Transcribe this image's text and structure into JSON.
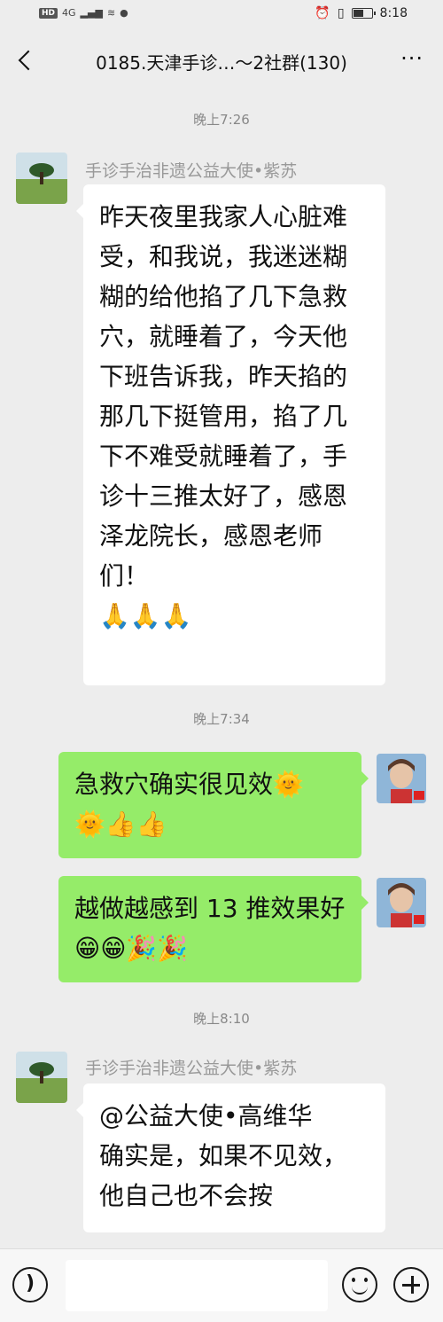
{
  "status_bar": {
    "hd": "HD",
    "network": "4G",
    "time": "8:18",
    "battery_level": 0.6
  },
  "header": {
    "title": "0185.天津手诊…～2社群(130)",
    "back_icon": "chevron-left-icon",
    "more_icon": "more-dots-icon",
    "more_label": "···"
  },
  "messages": [
    {
      "type": "time",
      "text": "晚上7:26"
    },
    {
      "type": "incoming",
      "sender": "手诊手治非遗公益大使•紫苏",
      "text": "昨天夜里我家人心脏难受，和我说，我迷迷糊糊的给他掐了几下急救穴，就睡着了，今天他下班告诉我，昨天掐的那几下挺管用，掐了几下不难受就睡着了，手诊十三推太好了，感恩泽龙院长，感恩老师们！\n🙏🙏🙏"
    },
    {
      "type": "time",
      "text": "晚上7:34"
    },
    {
      "type": "outgoing",
      "text": "急救穴确实很见效🌞\n🌞👍👍"
    },
    {
      "type": "outgoing",
      "text": "越做越感到 13 推效果好😁😁🎉🎉"
    },
    {
      "type": "time",
      "text": "晚上8:10"
    },
    {
      "type": "incoming",
      "sender": "手诊手治非遗公益大使•紫苏",
      "text": "@公益大使•高维华\n确实是，如果不见效，他自己也不会按"
    }
  ],
  "input_bar": {
    "voice_icon": "voice-icon",
    "emoji_icon": "emoji-icon",
    "plus_icon": "plus-icon"
  },
  "colors": {
    "background": "#ededed",
    "bubble_out": "#95ec69",
    "bubble_in": "#ffffff",
    "timestamp": "#888888"
  }
}
